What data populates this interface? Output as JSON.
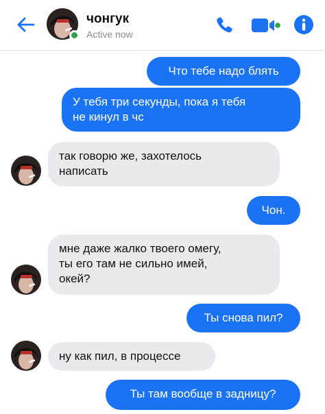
{
  "header": {
    "contact_name": "чонгук",
    "status": "Active now"
  },
  "icons": {
    "back": "back-arrow-icon",
    "call": "phone-icon",
    "video": "video-camera-icon",
    "info": "info-icon"
  },
  "colors": {
    "accent": "#1a73f4",
    "online": "#31a24c",
    "incoming_bubble": "#eaeaed"
  },
  "messages": [
    {
      "direction": "outgoing",
      "lines": [
        "Что тебе надо блять"
      ]
    },
    {
      "direction": "outgoing",
      "lines": [
        "У тебя три секунды, пока я тебя",
        "не кинул в чс"
      ]
    },
    {
      "direction": "incoming",
      "lines": [
        "так говорю же, захотелось",
        "написать"
      ]
    },
    {
      "direction": "outgoing",
      "lines": [
        "Чон."
      ]
    },
    {
      "direction": "incoming",
      "lines": [
        "мне даже жалко твоего омегу,",
        "ты его там не сильно имей,",
        "окей?"
      ]
    },
    {
      "direction": "outgoing",
      "lines": [
        "Ты снова пил?"
      ]
    },
    {
      "direction": "incoming",
      "lines": [
        "ну как пил, в процессе"
      ]
    },
    {
      "direction": "outgoing",
      "lines": [
        "Ты там вообще в задницу?"
      ]
    }
  ]
}
